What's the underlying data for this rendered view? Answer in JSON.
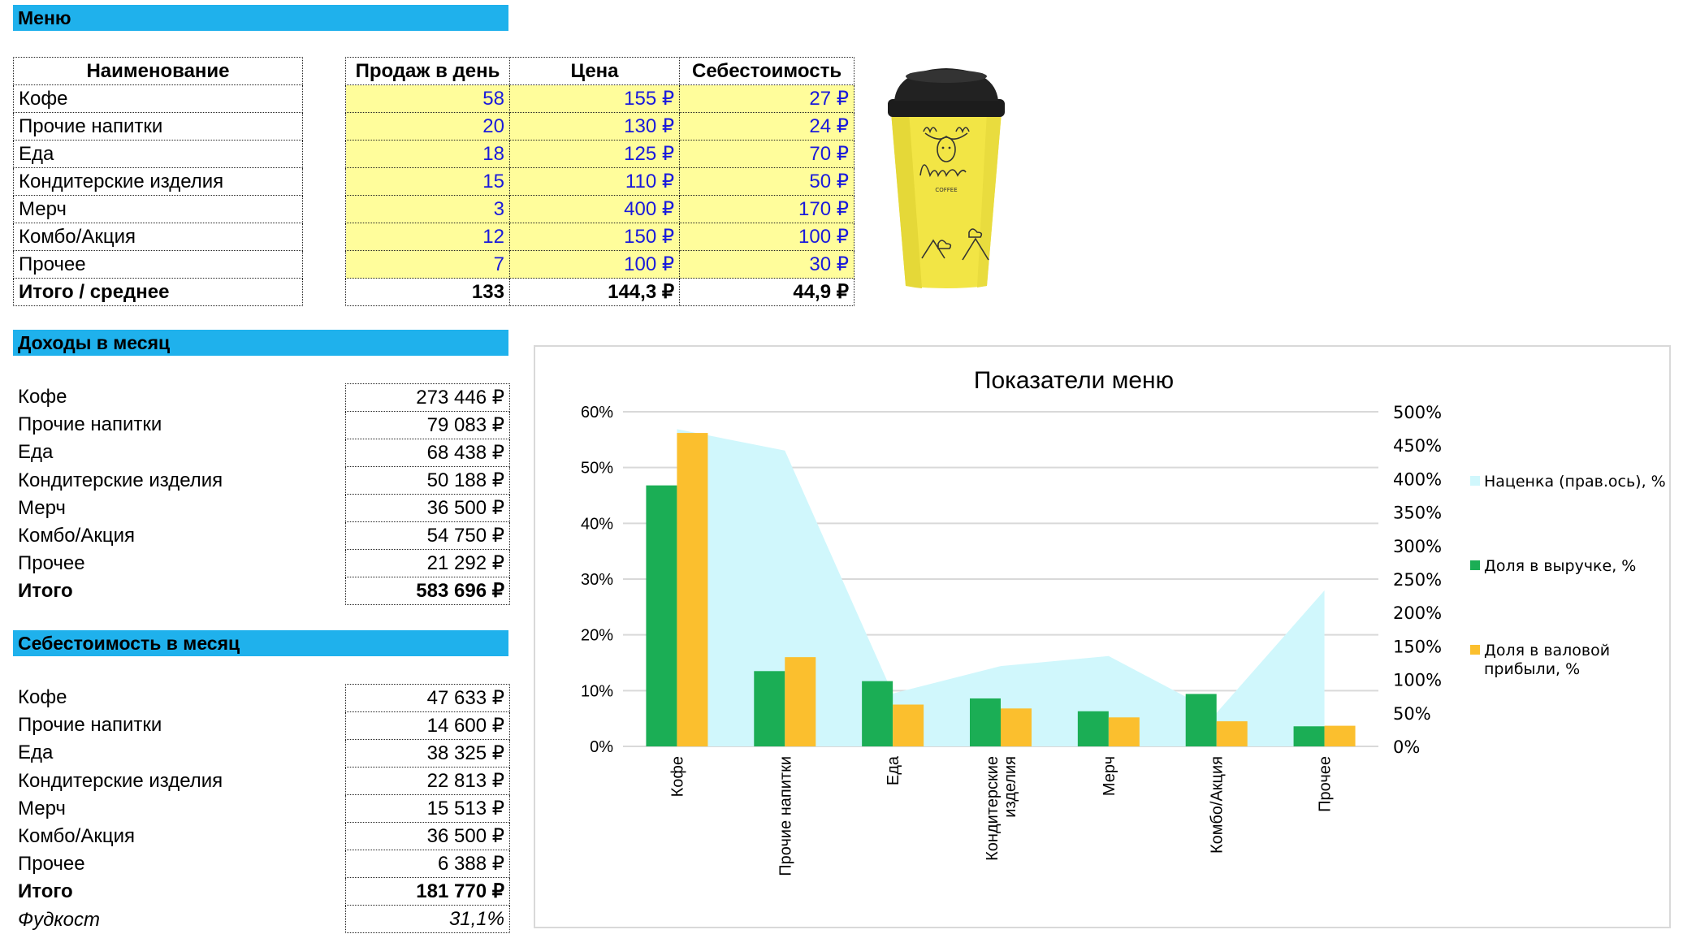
{
  "sections": {
    "menu": "Меню",
    "income": "Доходы в месяц",
    "cost": "Себестоимость в месяц"
  },
  "menu_table": {
    "headers": [
      "Наименование",
      "Продаж в день",
      "Цена",
      "Себестоимость"
    ],
    "rows": [
      {
        "name": "Кофе",
        "sales": "58",
        "price": "155 ₽",
        "cost": "27 ₽"
      },
      {
        "name": "Прочие напитки",
        "sales": "20",
        "price": "130 ₽",
        "cost": "24 ₽"
      },
      {
        "name": "Еда",
        "sales": "18",
        "price": "125 ₽",
        "cost": "70 ₽"
      },
      {
        "name": "Кондитерские изделия",
        "sales": "15",
        "price": "110 ₽",
        "cost": "50 ₽"
      },
      {
        "name": "Мерч",
        "sales": "3",
        "price": "400 ₽",
        "cost": "170 ₽"
      },
      {
        "name": "Комбо/Акция",
        "sales": "12",
        "price": "150 ₽",
        "cost": "100 ₽"
      },
      {
        "name": "Прочее",
        "sales": "7",
        "price": "100 ₽",
        "cost": "30 ₽"
      }
    ],
    "total": {
      "name": "Итого / среднее",
      "sales": "133",
      "price": "144,3 ₽",
      "cost": "44,9 ₽"
    }
  },
  "cup_image": {
    "brand": "Moose",
    "sub": "COFFEE",
    "icon": "coffee-cup-image"
  },
  "income_table": {
    "rows": [
      {
        "name": "Кофе",
        "value": "273 446 ₽"
      },
      {
        "name": "Прочие напитки",
        "value": "79 083 ₽"
      },
      {
        "name": "Еда",
        "value": "68 438 ₽"
      },
      {
        "name": "Кондитерские изделия",
        "value": "50 188 ₽"
      },
      {
        "name": "Мерч",
        "value": "36 500 ₽"
      },
      {
        "name": "Комбо/Акция",
        "value": "54 750 ₽"
      },
      {
        "name": "Прочее",
        "value": "21 292 ₽"
      }
    ],
    "total": {
      "name": "Итого",
      "value": "583 696 ₽"
    }
  },
  "cost_table": {
    "rows": [
      {
        "name": "Кофе",
        "value": "47 633 ₽"
      },
      {
        "name": "Прочие напитки",
        "value": "14 600 ₽"
      },
      {
        "name": "Еда",
        "value": "38 325 ₽"
      },
      {
        "name": "Кондитерские изделия",
        "value": "22 813 ₽"
      },
      {
        "name": "Мерч",
        "value": "15 513 ₽"
      },
      {
        "name": "Комбо/Акция",
        "value": "36 500 ₽"
      },
      {
        "name": "Прочее",
        "value": "6 388 ₽"
      }
    ],
    "total": {
      "name": "Итого",
      "value": "181 770 ₽"
    },
    "foodcost": {
      "name": "Фудкост",
      "value": "31,1%"
    }
  },
  "chart_data": {
    "type": "bar",
    "title": "Показатели меню",
    "categories": [
      "Кофе",
      "Прочие напитки",
      "Еда",
      "Кондитерские изделия",
      "Мерч",
      "Комбо/Акция",
      "Прочее"
    ],
    "category_label_lines": [
      [
        "Кофе"
      ],
      [
        "Прочие напитки"
      ],
      [
        "Еда"
      ],
      [
        "Кондитерские",
        "изделия"
      ],
      [
        "Мерч"
      ],
      [
        "Комбо/Акция"
      ],
      [
        "Прочее"
      ]
    ],
    "series": [
      {
        "name": "Наценка (прав.ось), %",
        "type": "area",
        "axis": "right",
        "color": "#d0f7fc",
        "values": [
          474,
          442,
          79,
          120,
          135,
          50,
          233
        ]
      },
      {
        "name": "Доля в выручке, %",
        "type": "bar",
        "axis": "left",
        "color": "#1bae55",
        "values": [
          46.8,
          13.5,
          11.7,
          8.6,
          6.3,
          9.4,
          3.6
        ]
      },
      {
        "name": "Доля в валовой прибыли, %",
        "type": "bar",
        "axis": "left",
        "color": "#fbbf2e",
        "values": [
          56.2,
          16.0,
          7.5,
          6.8,
          5.2,
          4.5,
          3.7
        ]
      }
    ],
    "legend_labels": [
      [
        "Наценка (прав.ось), %"
      ],
      [
        "Доля в выручке, %"
      ],
      [
        "Доля в валовой",
        "прибыли, %"
      ]
    ],
    "ylim": [
      0,
      60
    ],
    "yticks": [
      "0%",
      "10%",
      "20%",
      "30%",
      "40%",
      "50%",
      "60%"
    ],
    "y2lim": [
      0,
      500
    ],
    "y2ticks": [
      "0%",
      "50%",
      "100%",
      "150%",
      "200%",
      "250%",
      "300%",
      "350%",
      "400%",
      "450%",
      "500%"
    ],
    "grid": true,
    "legend_position": "right"
  }
}
